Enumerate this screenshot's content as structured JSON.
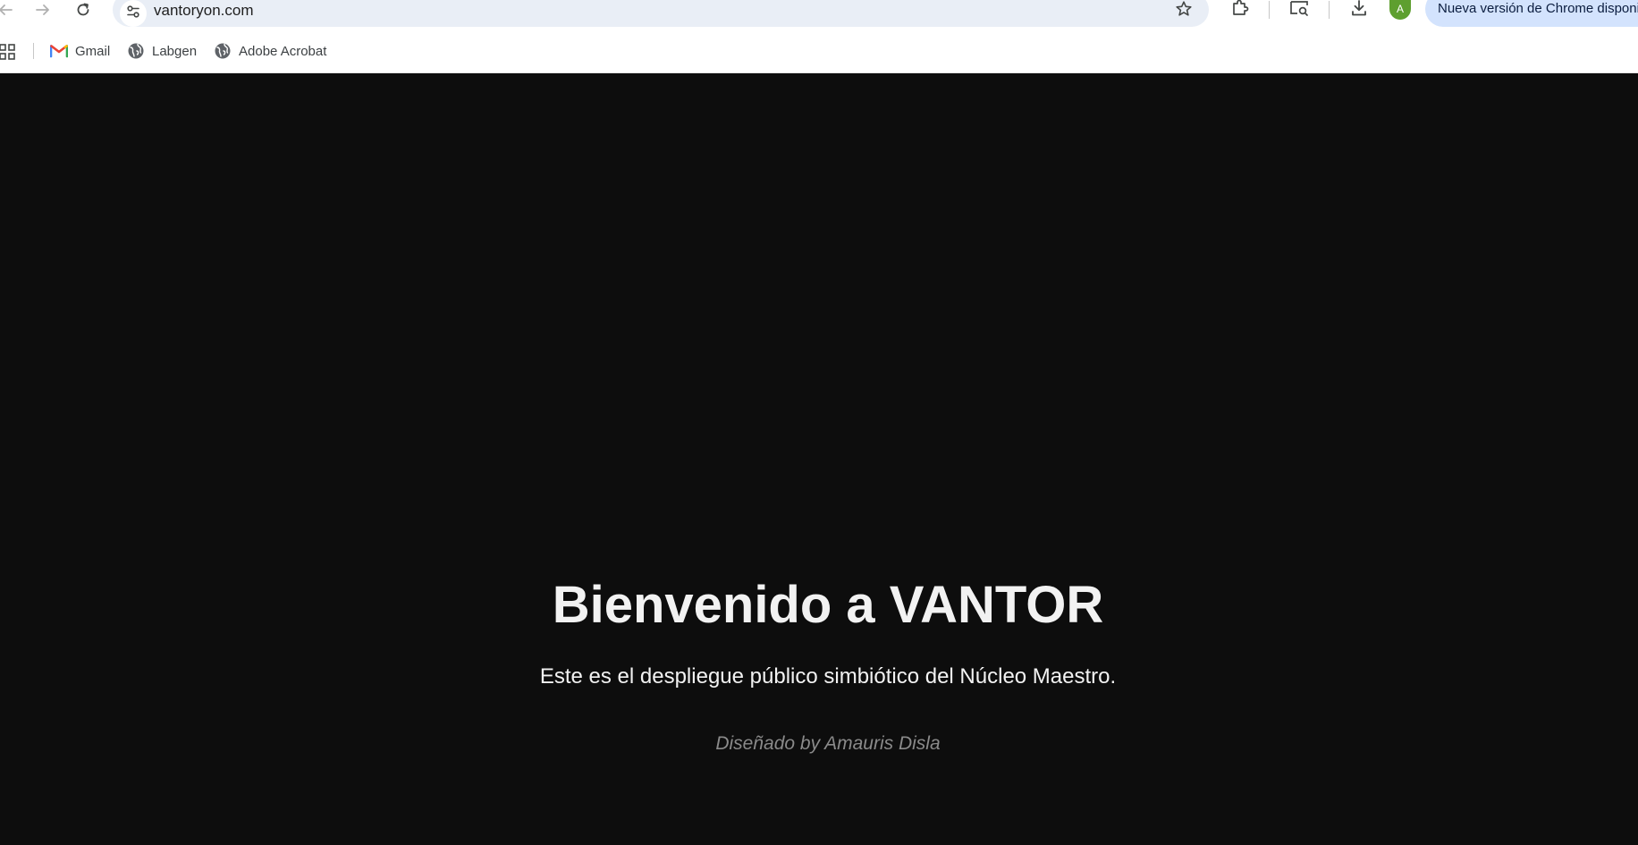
{
  "browser": {
    "url": "vantoryon.com",
    "update_label": "Nueva versión de Chrome disponible",
    "profile_initial": "A",
    "colors": {
      "omnibox_bg": "#e9eef6",
      "update_pill_bg": "#d3e3fd",
      "avatar_bg": "#5e9f2f"
    },
    "icons": {
      "back": "arrow-left-icon",
      "forward": "arrow-right-icon",
      "reload": "reload-icon",
      "site_info": "tune-icon",
      "bookmark": "star-icon",
      "extensions": "puzzle-icon",
      "tab_search": "tab-search-icon",
      "downloads": "download-icon"
    }
  },
  "bookmarks": {
    "items": [
      {
        "label": "Gmail",
        "icon": "gmail-icon"
      },
      {
        "label": "Labgen",
        "icon": "globe-icon"
      },
      {
        "label": "Adobe Acrobat",
        "icon": "globe-icon"
      }
    ]
  },
  "page": {
    "background": "#0d0d0d",
    "title": "Bienvenido a VANTOR",
    "subtitle": "Este es el despliegue público simbiótico del Núcleo Maestro.",
    "credit": "Diseñado by Amauris Disla"
  }
}
